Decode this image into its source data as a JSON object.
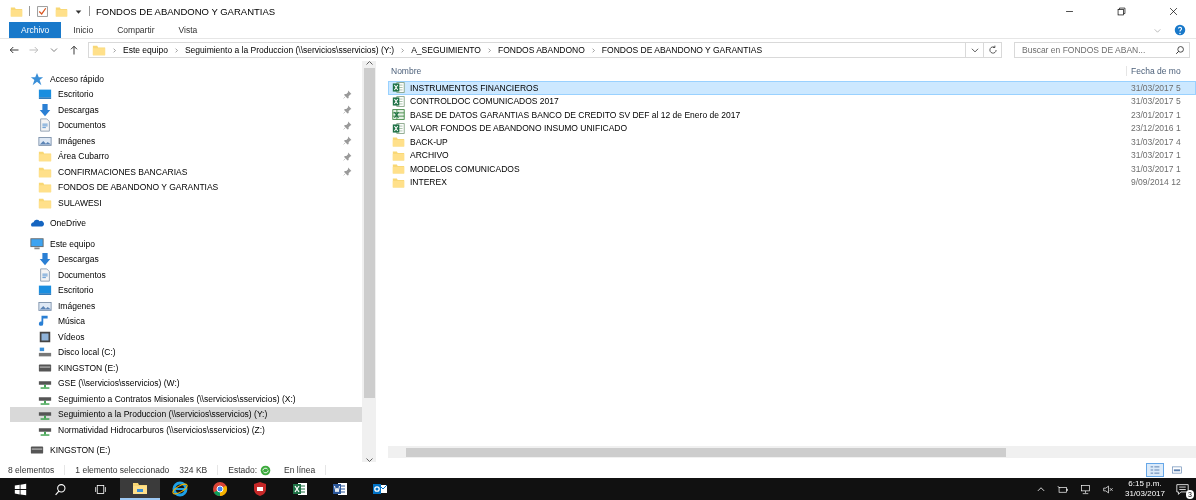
{
  "window": {
    "title": "FONDOS DE ABANDONO Y GARANTIAS"
  },
  "ribbon": {
    "tabs": [
      {
        "label": "Archivo",
        "selected": true
      },
      {
        "label": "Inicio",
        "selected": false
      },
      {
        "label": "Compartir",
        "selected": false
      },
      {
        "label": "Vista",
        "selected": false
      }
    ]
  },
  "address": {
    "crumbs": [
      "Este equipo",
      "Seguimiento a la Produccion (\\\\servicios\\sservicios) (Y:)",
      "A_SEGUIMIENTO",
      "FONDOS ABANDONO",
      "FONDOS DE ABANDONO Y GARANTIAS"
    ]
  },
  "search": {
    "placeholder": "Buscar en FONDOS DE ABAN..."
  },
  "nav": [
    {
      "label": "Acceso rápido",
      "kind": "star",
      "children": [
        {
          "label": "Escritorio",
          "kind": "desktop",
          "pinned": true,
          "selected": false
        },
        {
          "label": "Descargas",
          "kind": "download",
          "pinned": true,
          "selected": false
        },
        {
          "label": "Documentos",
          "kind": "documents",
          "pinned": true,
          "selected": false
        },
        {
          "label": "Imágenes",
          "kind": "pictures",
          "pinned": true,
          "selected": false
        },
        {
          "label": "Área Cubarro",
          "kind": "folder",
          "pinned": true,
          "selected": false
        },
        {
          "label": "CONFIRMACIONES BANCARIAS",
          "kind": "folder",
          "pinned": true,
          "selected": false
        },
        {
          "label": "FONDOS DE ABANDONO Y GARANTIAS",
          "kind": "folder",
          "pinned": false,
          "selected": false
        },
        {
          "label": "SULAWESI",
          "kind": "folder",
          "pinned": false,
          "selected": false
        }
      ]
    },
    {
      "label": "OneDrive",
      "kind": "cloud"
    },
    {
      "label": "Este equipo",
      "kind": "pc",
      "children": [
        {
          "label": "Descargas",
          "kind": "download",
          "pinned": false,
          "selected": false
        },
        {
          "label": "Documentos",
          "kind": "documents",
          "pinned": false,
          "selected": false
        },
        {
          "label": "Escritorio",
          "kind": "desktop",
          "pinned": false,
          "selected": false
        },
        {
          "label": "Imágenes",
          "kind": "pictures",
          "pinned": false,
          "selected": false
        },
        {
          "label": "Música",
          "kind": "music",
          "pinned": false,
          "selected": false
        },
        {
          "label": "Vídeos",
          "kind": "video",
          "pinned": false,
          "selected": false
        },
        {
          "label": "Disco local (C:)",
          "kind": "disk",
          "pinned": false,
          "selected": false
        },
        {
          "label": "KINGSTON (E:)",
          "kind": "usb",
          "pinned": false,
          "selected": false
        },
        {
          "label": "GSE (\\\\servicios\\sservicios) (W:)",
          "kind": "network",
          "pinned": false,
          "selected": false
        },
        {
          "label": "Seguimiento a Contratos Misionales (\\\\servicios\\sservicios) (X:)",
          "kind": "network",
          "pinned": false,
          "selected": false
        },
        {
          "label": "Seguimiento a la Produccion (\\\\servicios\\sservicios) (Y:)",
          "kind": "network",
          "pinned": false,
          "selected": true
        },
        {
          "label": "Normatividad Hidrocarburos (\\\\servicios\\sservicios) (Z:)",
          "kind": "network",
          "pinned": false,
          "selected": false
        }
      ]
    },
    {
      "label": "KINGSTON (E:)",
      "kind": "usb"
    }
  ],
  "files": {
    "columns": [
      "Nombre",
      "Fecha de mo"
    ],
    "rows": [
      {
        "name": "INSTRUMENTOS FINANCIEROS",
        "date": "31/03/2017 5",
        "kind": "excel",
        "selected": true
      },
      {
        "name": "CONTROLDOC COMUNICADOS 2017",
        "date": "31/03/2017 5",
        "kind": "excel",
        "selected": false
      },
      {
        "name": "BASE DE DATOS GARANTIAS BANCO DE CREDITO SV DEF al 12 de Enero de 2017",
        "date": "23/01/2017 1",
        "kind": "excel-old",
        "selected": false
      },
      {
        "name": "VALOR FONDOS DE ABANDONO INSUMO UNIFICADO",
        "date": "23/12/2016 1",
        "kind": "excel",
        "selected": false
      },
      {
        "name": "BACK-UP",
        "date": "31/03/2017 4",
        "kind": "folder",
        "selected": false
      },
      {
        "name": "ARCHIVO",
        "date": "31/03/2017 1",
        "kind": "folder",
        "selected": false
      },
      {
        "name": "MODELOS COMUNICADOS",
        "date": "31/03/2017 1",
        "kind": "folder",
        "selected": false
      },
      {
        "name": "INTEREX",
        "date": "9/09/2014 12",
        "kind": "folder",
        "selected": false
      }
    ]
  },
  "status_bar": {
    "count": "8 elementos",
    "selection": "1 elemento seleccionado",
    "size": "324 KB",
    "state_label": "Estado:",
    "state_value": "En línea"
  },
  "taskbar": {
    "apps": [
      {
        "kind": "explorer",
        "active": true
      },
      {
        "kind": "ie",
        "active": false
      },
      {
        "kind": "chrome",
        "active": false
      },
      {
        "kind": "shield",
        "active": false
      },
      {
        "kind": "excel",
        "active": false
      },
      {
        "kind": "word",
        "active": false
      },
      {
        "kind": "outlook",
        "active": false
      }
    ],
    "time": "6:15 p.m.",
    "date": "31/03/2017",
    "notifications": "3"
  }
}
